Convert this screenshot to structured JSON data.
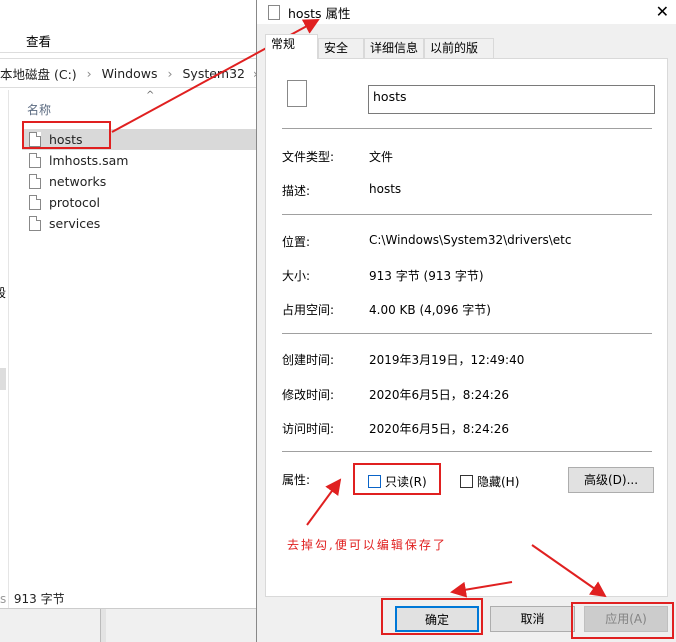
{
  "explorer": {
    "menu_view": "查看",
    "breadcrumb": [
      "本地磁盘 (C:)",
      "Windows",
      "System32",
      "d"
    ],
    "column_name": "名称",
    "files": [
      "hosts",
      "lmhosts.sam",
      "networks",
      "protocol",
      "services"
    ],
    "side_char": "段",
    "status": "913 字节"
  },
  "dialog": {
    "title": "hosts 属性",
    "tabs": [
      "常规",
      "安全",
      "详细信息",
      "以前的版本"
    ],
    "filename": "hosts",
    "fields": [
      {
        "label": "文件类型:",
        "value": "文件"
      },
      {
        "label": "描述:",
        "value": "hosts"
      },
      {
        "label": "位置:",
        "value": "C:\\Windows\\System32\\drivers\\etc"
      },
      {
        "label": "大小:",
        "value": "913 字节 (913 字节)"
      },
      {
        "label": "占用空间:",
        "value": "4.00 KB (4,096 字节)"
      },
      {
        "label": "创建时间:",
        "value": "2019年3月19日，12:49:40"
      },
      {
        "label": "修改时间:",
        "value": "2020年6月5日，8:24:26"
      },
      {
        "label": "访问时间:",
        "value": "2020年6月5日，8:24:26"
      }
    ],
    "attributes_label": "属性:",
    "readonly": {
      "label": "只读(R)",
      "checked": false
    },
    "hidden": {
      "label": "隐藏(H)",
      "checked": false
    },
    "advanced": "高级(D)...",
    "ok": "确定",
    "cancel": "取消",
    "apply": "应用(A)",
    "close_icon": "close-icon"
  },
  "annotation": {
    "text": "去掉勾,便可以编辑保存了",
    "color": "#e02020"
  }
}
